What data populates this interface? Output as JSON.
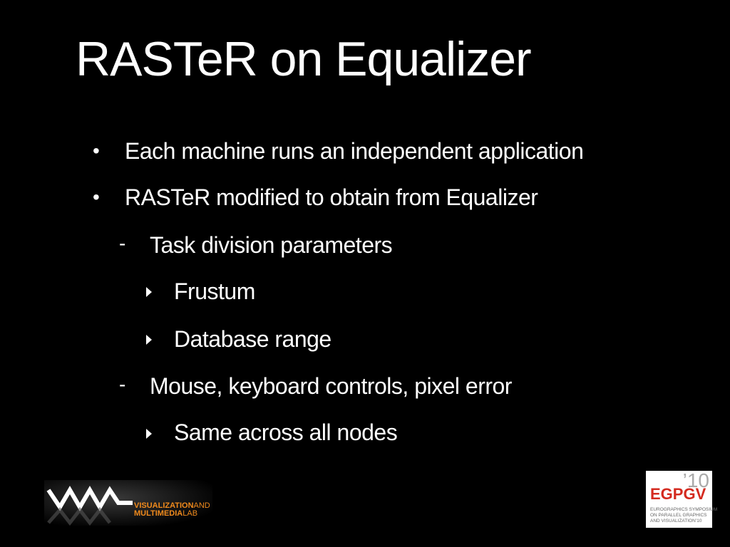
{
  "slide": {
    "title": "RASTeR on Equalizer",
    "items": [
      {
        "level": 1,
        "marker": "•",
        "text": "Each machine runs an independent application"
      },
      {
        "level": 1,
        "marker": "•",
        "text": "RASTeR modified to obtain from Equalizer"
      },
      {
        "level": 2,
        "marker": "-",
        "text": "Task division parameters"
      },
      {
        "level": 3,
        "marker": "triangle",
        "text": "Frustum"
      },
      {
        "level": 3,
        "marker": "triangle",
        "text": "Database range"
      },
      {
        "level": 2,
        "marker": "-",
        "text": "Mouse, keyboard controls, pixel error"
      },
      {
        "level": 3,
        "marker": "triangle",
        "text": "Same across all nodes"
      }
    ]
  },
  "logos": {
    "vml": {
      "line1_bold": "VISUALIZATION",
      "line1_light": "AND",
      "line2_bold": "MULTIMEDIA",
      "line2_light": "LAB",
      "color": "#f08a1c"
    },
    "egpgv": {
      "year": "’10",
      "acronym": "EGPGV",
      "line1": "EUROGRAPHICS SYMPOSIUM",
      "line2": "ON PARALLEL GRAPHICS",
      "line3": "AND VISUALIZATION’10",
      "color": "#d42a1f"
    }
  }
}
